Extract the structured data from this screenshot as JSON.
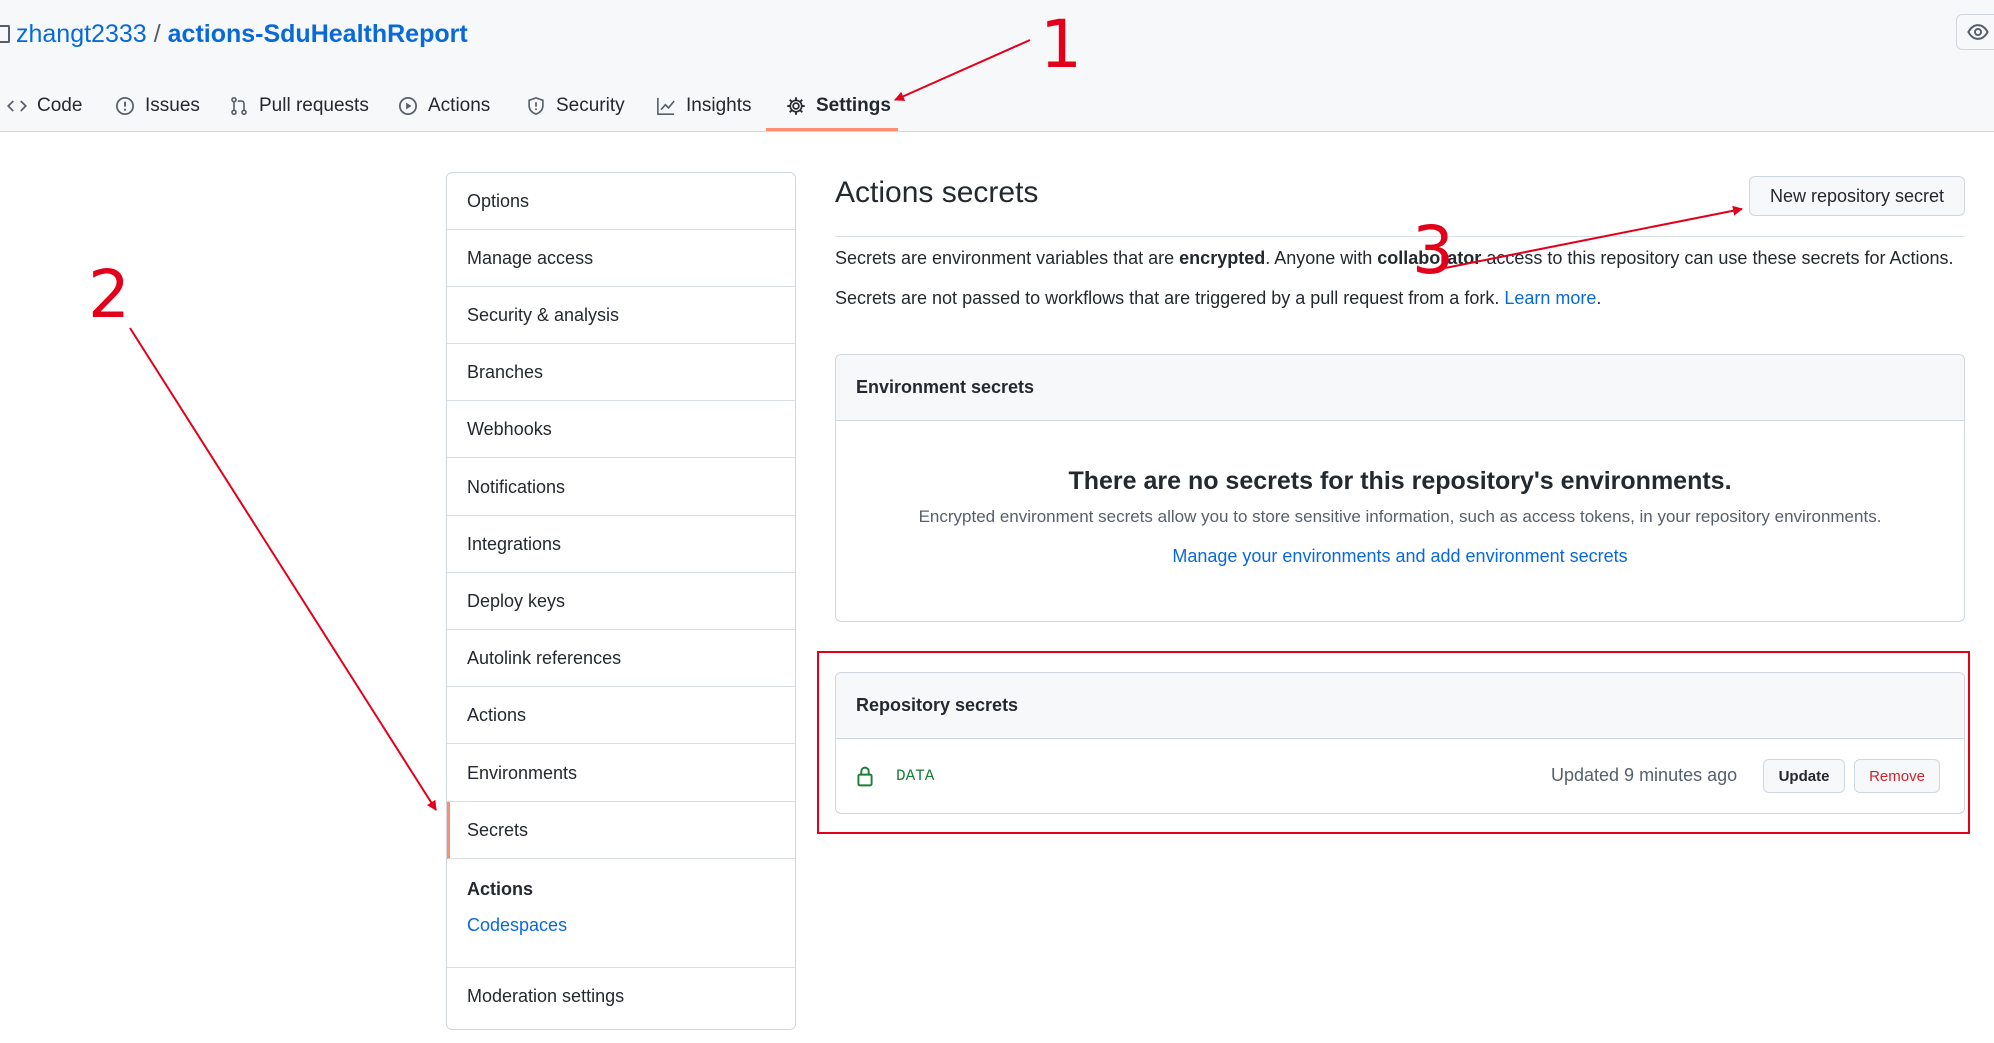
{
  "header": {
    "owner": "zhangt2333",
    "separator": "/",
    "repo": "actions-SduHealthReport"
  },
  "tabs": [
    {
      "label": "Code",
      "icon": "code-icon"
    },
    {
      "label": "Issues",
      "icon": "issue-icon"
    },
    {
      "label": "Pull requests",
      "icon": "pull-request-icon"
    },
    {
      "label": "Actions",
      "icon": "play-icon"
    },
    {
      "label": "Security",
      "icon": "shield-icon"
    },
    {
      "label": "Insights",
      "icon": "graph-icon"
    },
    {
      "label": "Settings",
      "icon": "gear-icon",
      "selected": true
    }
  ],
  "sidebar": {
    "items": [
      "Options",
      "Manage access",
      "Security & analysis",
      "Branches",
      "Webhooks",
      "Notifications",
      "Integrations",
      "Deploy keys",
      "Autolink references",
      "Actions",
      "Environments",
      "Secrets"
    ],
    "selected": "Secrets",
    "section_heading": "Actions",
    "section_link": "Codespaces",
    "last_item": "Moderation settings"
  },
  "main": {
    "title": "Actions secrets",
    "new_secret_button": "New repository secret",
    "desc1_a": "Secrets are environment variables that are ",
    "desc1_b": "encrypted",
    "desc1_c": ". Anyone with ",
    "desc1_d": "collaborator",
    "desc1_e": " access to this repository can use these secrets for Actions.",
    "desc2": "Secrets are not passed to workflows that are triggered by a pull request from a fork. ",
    "learn_more": "Learn more",
    "period": "."
  },
  "env_secrets": {
    "header": "Environment secrets",
    "blank_title": "There are no secrets for this repository's environments.",
    "blank_text": "Encrypted environment secrets allow you to store sensitive information, such as access tokens, in your repository environments.",
    "manage_link": "Manage your environments and add environment secrets"
  },
  "repo_secrets": {
    "header": "Repository secrets",
    "secret": {
      "name": "DATA",
      "updated": "Updated 9 minutes ago",
      "update_label": "Update",
      "remove_label": "Remove"
    }
  },
  "annotations": [
    "1",
    "2",
    "3"
  ],
  "colors": {
    "accent": "#0969da",
    "annotation": "#e3001b",
    "selected_underline": "#fd8c73",
    "secret_name": "#1a7f37"
  }
}
